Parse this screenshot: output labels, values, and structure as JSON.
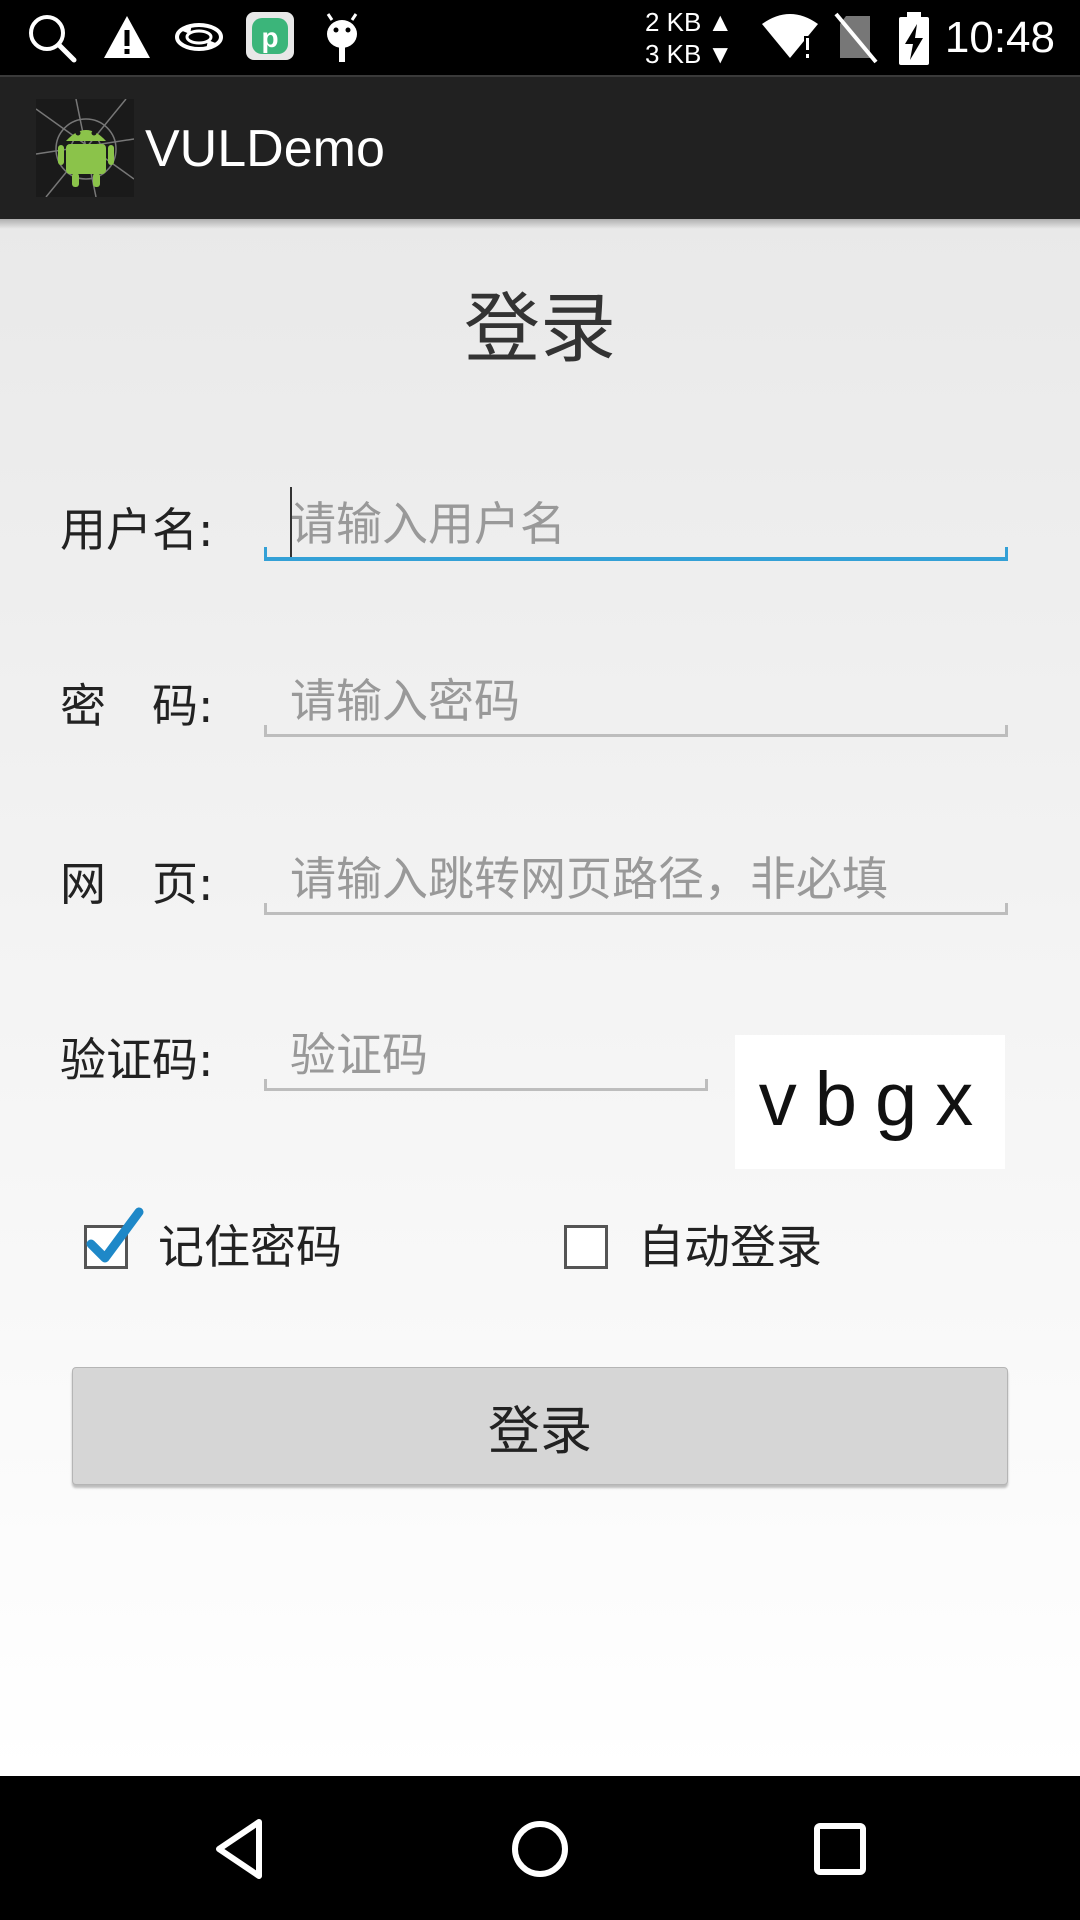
{
  "status_bar": {
    "icons": [
      "search-icon",
      "warning-icon",
      "sync-icon",
      "app-p-icon",
      "android-debug-icon"
    ],
    "net_up": "2 KB",
    "net_down": "3 KB",
    "signal_icon": "wifi-no-internet-icon",
    "sim_icon": "no-sim-icon",
    "battery_icon": "battery-charging-icon",
    "time": "10:48"
  },
  "action_bar": {
    "app_title": "VULDemo",
    "app_icon": "android-logo-icon"
  },
  "form": {
    "title": "登录",
    "username": {
      "label": "用户名:",
      "placeholder": "请输入用户名",
      "value": ""
    },
    "password": {
      "label": "密　码:",
      "placeholder": "请输入密码",
      "value": ""
    },
    "webpage": {
      "label": "网　页:",
      "placeholder": "请输入跳转网页路径，非必填",
      "value": ""
    },
    "captcha": {
      "label": "验证码:",
      "placeholder": "验证码",
      "value": "",
      "image_text": "vbgx"
    },
    "remember_password": {
      "label": "记住密码",
      "checked": true
    },
    "auto_login": {
      "label": "自动登录",
      "checked": false
    },
    "submit_label": "登录"
  },
  "nav_bar": {
    "back": "back-icon",
    "home": "home-icon",
    "recents": "recents-icon"
  },
  "colors": {
    "accent": "#33a0d6",
    "action_bar": "#212121",
    "status_bar": "#000000"
  }
}
